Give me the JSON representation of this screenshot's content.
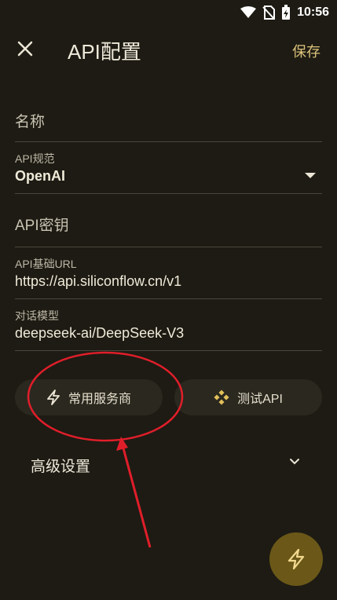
{
  "status_bar": {
    "time": "10:56"
  },
  "appbar": {
    "title": "API配置",
    "save_label": "保存"
  },
  "form": {
    "name_placeholder": "名称",
    "spec_label": "API规范",
    "spec_value": "OpenAI",
    "key_placeholder": "API密钥",
    "base_url_label": "API基础URL",
    "base_url_value": "https://api.siliconflow.cn/v1",
    "model_label": "对话模型",
    "model_value": "deepseek-ai/DeepSeek-V3"
  },
  "actions": {
    "providers_label": "常用服务商",
    "test_label": "测试API"
  },
  "advanced": {
    "label": "高级设置"
  },
  "colors": {
    "background": "#1d1b13",
    "accent": "#dcc27b",
    "fab": "#6b5818",
    "annotation": "#e01e2a"
  }
}
